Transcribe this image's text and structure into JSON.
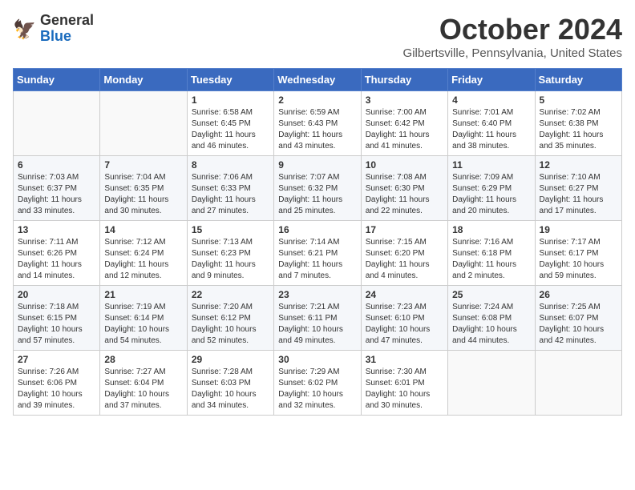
{
  "header": {
    "logo_general": "General",
    "logo_blue": "Blue",
    "month_title": "October 2024",
    "location": "Gilbertsville, Pennsylvania, United States"
  },
  "weekdays": [
    "Sunday",
    "Monday",
    "Tuesday",
    "Wednesday",
    "Thursday",
    "Friday",
    "Saturday"
  ],
  "weeks": [
    [
      {
        "day": "",
        "info": ""
      },
      {
        "day": "",
        "info": ""
      },
      {
        "day": "1",
        "info": "Sunrise: 6:58 AM\nSunset: 6:45 PM\nDaylight: 11 hours and 46 minutes."
      },
      {
        "day": "2",
        "info": "Sunrise: 6:59 AM\nSunset: 6:43 PM\nDaylight: 11 hours and 43 minutes."
      },
      {
        "day": "3",
        "info": "Sunrise: 7:00 AM\nSunset: 6:42 PM\nDaylight: 11 hours and 41 minutes."
      },
      {
        "day": "4",
        "info": "Sunrise: 7:01 AM\nSunset: 6:40 PM\nDaylight: 11 hours and 38 minutes."
      },
      {
        "day": "5",
        "info": "Sunrise: 7:02 AM\nSunset: 6:38 PM\nDaylight: 11 hours and 35 minutes."
      }
    ],
    [
      {
        "day": "6",
        "info": "Sunrise: 7:03 AM\nSunset: 6:37 PM\nDaylight: 11 hours and 33 minutes."
      },
      {
        "day": "7",
        "info": "Sunrise: 7:04 AM\nSunset: 6:35 PM\nDaylight: 11 hours and 30 minutes."
      },
      {
        "day": "8",
        "info": "Sunrise: 7:06 AM\nSunset: 6:33 PM\nDaylight: 11 hours and 27 minutes."
      },
      {
        "day": "9",
        "info": "Sunrise: 7:07 AM\nSunset: 6:32 PM\nDaylight: 11 hours and 25 minutes."
      },
      {
        "day": "10",
        "info": "Sunrise: 7:08 AM\nSunset: 6:30 PM\nDaylight: 11 hours and 22 minutes."
      },
      {
        "day": "11",
        "info": "Sunrise: 7:09 AM\nSunset: 6:29 PM\nDaylight: 11 hours and 20 minutes."
      },
      {
        "day": "12",
        "info": "Sunrise: 7:10 AM\nSunset: 6:27 PM\nDaylight: 11 hours and 17 minutes."
      }
    ],
    [
      {
        "day": "13",
        "info": "Sunrise: 7:11 AM\nSunset: 6:26 PM\nDaylight: 11 hours and 14 minutes."
      },
      {
        "day": "14",
        "info": "Sunrise: 7:12 AM\nSunset: 6:24 PM\nDaylight: 11 hours and 12 minutes."
      },
      {
        "day": "15",
        "info": "Sunrise: 7:13 AM\nSunset: 6:23 PM\nDaylight: 11 hours and 9 minutes."
      },
      {
        "day": "16",
        "info": "Sunrise: 7:14 AM\nSunset: 6:21 PM\nDaylight: 11 hours and 7 minutes."
      },
      {
        "day": "17",
        "info": "Sunrise: 7:15 AM\nSunset: 6:20 PM\nDaylight: 11 hours and 4 minutes."
      },
      {
        "day": "18",
        "info": "Sunrise: 7:16 AM\nSunset: 6:18 PM\nDaylight: 11 hours and 2 minutes."
      },
      {
        "day": "19",
        "info": "Sunrise: 7:17 AM\nSunset: 6:17 PM\nDaylight: 10 hours and 59 minutes."
      }
    ],
    [
      {
        "day": "20",
        "info": "Sunrise: 7:18 AM\nSunset: 6:15 PM\nDaylight: 10 hours and 57 minutes."
      },
      {
        "day": "21",
        "info": "Sunrise: 7:19 AM\nSunset: 6:14 PM\nDaylight: 10 hours and 54 minutes."
      },
      {
        "day": "22",
        "info": "Sunrise: 7:20 AM\nSunset: 6:12 PM\nDaylight: 10 hours and 52 minutes."
      },
      {
        "day": "23",
        "info": "Sunrise: 7:21 AM\nSunset: 6:11 PM\nDaylight: 10 hours and 49 minutes."
      },
      {
        "day": "24",
        "info": "Sunrise: 7:23 AM\nSunset: 6:10 PM\nDaylight: 10 hours and 47 minutes."
      },
      {
        "day": "25",
        "info": "Sunrise: 7:24 AM\nSunset: 6:08 PM\nDaylight: 10 hours and 44 minutes."
      },
      {
        "day": "26",
        "info": "Sunrise: 7:25 AM\nSunset: 6:07 PM\nDaylight: 10 hours and 42 minutes."
      }
    ],
    [
      {
        "day": "27",
        "info": "Sunrise: 7:26 AM\nSunset: 6:06 PM\nDaylight: 10 hours and 39 minutes."
      },
      {
        "day": "28",
        "info": "Sunrise: 7:27 AM\nSunset: 6:04 PM\nDaylight: 10 hours and 37 minutes."
      },
      {
        "day": "29",
        "info": "Sunrise: 7:28 AM\nSunset: 6:03 PM\nDaylight: 10 hours and 34 minutes."
      },
      {
        "day": "30",
        "info": "Sunrise: 7:29 AM\nSunset: 6:02 PM\nDaylight: 10 hours and 32 minutes."
      },
      {
        "day": "31",
        "info": "Sunrise: 7:30 AM\nSunset: 6:01 PM\nDaylight: 10 hours and 30 minutes."
      },
      {
        "day": "",
        "info": ""
      },
      {
        "day": "",
        "info": ""
      }
    ]
  ]
}
